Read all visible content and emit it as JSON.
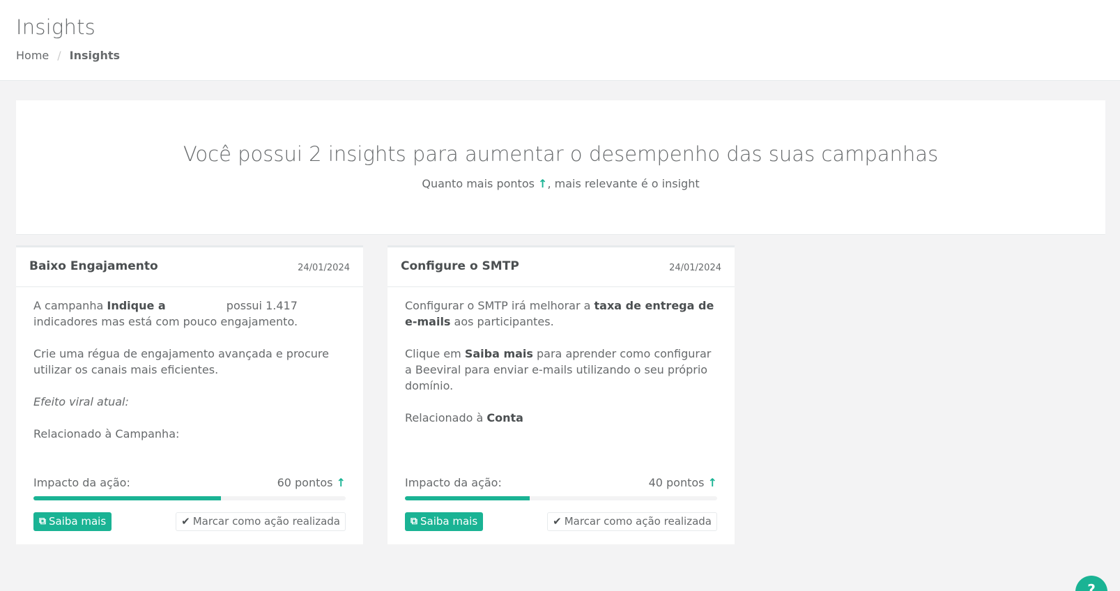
{
  "header": {
    "title": "Insights",
    "breadcrumb": {
      "home": "Home",
      "separator": "/",
      "current": "Insights"
    }
  },
  "summary": {
    "title": "Você possui 2 insights para aumentar o desempenho das suas campanhas",
    "sub_prefix": "Quanto mais pontos",
    "sub_suffix": ", mais relevante é o insight",
    "arrow_icon": "↑"
  },
  "cards": [
    {
      "title": "Baixo Engajamento",
      "date": "24/01/2024",
      "p1_a": "A campanha ",
      "p1_b": "Indique a",
      "p1_c": " possui 1.417 indicadores mas está com pouco engajamento.",
      "p2": "Crie uma régua de engajamento avançada e procure utilizar os canais mais eficientes.",
      "p3": "Efeito viral atual:",
      "p4": "Relacionado à Campanha:",
      "impact_label": "Impacto da ação:",
      "impact_value": "60 pontos",
      "impact_fraction": 0.6,
      "primary_label": "Saiba mais",
      "secondary_label": "Marcar como ação realizada"
    },
    {
      "title": "Configure o SMTP",
      "date": "24/01/2024",
      "p1_a": "Configurar o SMTP irá melhorar a ",
      "p1_b": "taxa de entrega de e-mails",
      "p1_c": " aos participantes.",
      "p2_a": "Clique em ",
      "p2_b": "Saiba mais",
      "p2_c": " para aprender como configurar a Beeviral para enviar e-mails utilizando o seu próprio domínio.",
      "p3_a": "Relacionado à ",
      "p3_b": "Conta",
      "impact_label": "Impacto da ação:",
      "impact_value": "40 pontos",
      "impact_fraction": 0.4,
      "primary_label": "Saiba mais",
      "secondary_label": "Marcar como ação realizada"
    }
  ],
  "help": {
    "label": "?"
  },
  "colors": {
    "accent": "#1ab394",
    "text": "#676a6c",
    "background": "#f3f3f4"
  }
}
